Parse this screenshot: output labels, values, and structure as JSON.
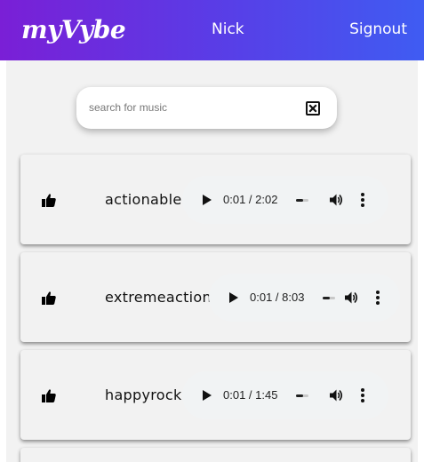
{
  "app": {
    "logo": "myVybe",
    "user_name": "Nick",
    "signout_label": "Signout"
  },
  "search": {
    "placeholder": "search for music",
    "value": ""
  },
  "songs": [
    {
      "title": "actionable",
      "current_time": "0:01",
      "duration": "2:02",
      "time_display": "0:01 / 2:02",
      "progress": 0.008
    },
    {
      "title": "extremeaction",
      "current_time": "0:01",
      "duration": "8:03",
      "time_display": "0:01 / 8:03",
      "progress": 0.002
    },
    {
      "title": "happyrock",
      "current_time": "0:01",
      "duration": "1:45",
      "time_display": "0:01 / 1:45",
      "progress": 0.01
    }
  ],
  "icons": {
    "like": "thumbs-up-icon",
    "clear": "clear-x-icon",
    "play": "play-icon",
    "volume": "volume-icon",
    "more": "more-vertical-icon"
  },
  "colors": {
    "header_gradient_start": "#7a1fd6",
    "header_gradient_end": "#3f5cf2",
    "content_background": "#f2f2f2",
    "player_background": "#f1f3f4"
  }
}
